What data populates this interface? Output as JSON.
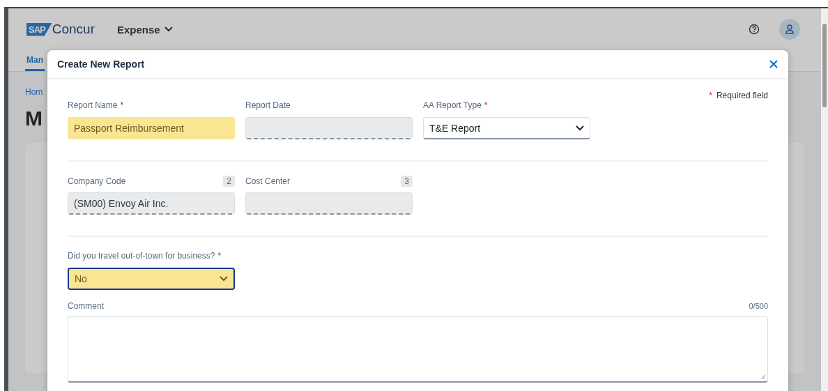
{
  "app_header": {
    "logo": "SAP",
    "brand": "Concur",
    "menu": "Expense"
  },
  "tabs": [
    {
      "label": "Man",
      "selected": true
    }
  ],
  "breadcrumb": "Hom",
  "page_heading": "M",
  "dialog": {
    "title": "Create New Report",
    "required_note": {
      "mark": "*",
      "text": "Required field"
    },
    "sections": [
      {
        "fields": [
          {
            "label": "Report Name",
            "required_mark": "*",
            "kind": "text",
            "value": "Passport Reimbursement",
            "highlighted": true,
            "disabled": false,
            "focused": false
          },
          {
            "label": "Report Date",
            "kind": "text",
            "disabled": true,
            "highlighted": false,
            "focused": false
          },
          {
            "label": "AA Report Type",
            "required_mark": "*",
            "kind": "select",
            "value": "T&E Report",
            "highlighted": false,
            "disabled": false,
            "focused": false
          }
        ]
      },
      {
        "fields": [
          {
            "label": "Company Code",
            "badge": "2",
            "kind": "text",
            "value": "(SM00) Envoy Air Inc.",
            "disabled": true,
            "highlighted": false,
            "focused": false
          },
          {
            "label": "Cost Center",
            "badge": "3",
            "kind": "text",
            "disabled": true,
            "highlighted": false,
            "focused": false
          }
        ]
      },
      {
        "fields": [
          {
            "label": "Did you travel out-of-town for business?",
            "required_mark": "*",
            "kind": "select",
            "value": "No",
            "highlighted": true,
            "disabled": false,
            "focused": true
          }
        ]
      }
    ],
    "comment": {
      "label": "Comment",
      "counter": "0/500"
    }
  }
}
